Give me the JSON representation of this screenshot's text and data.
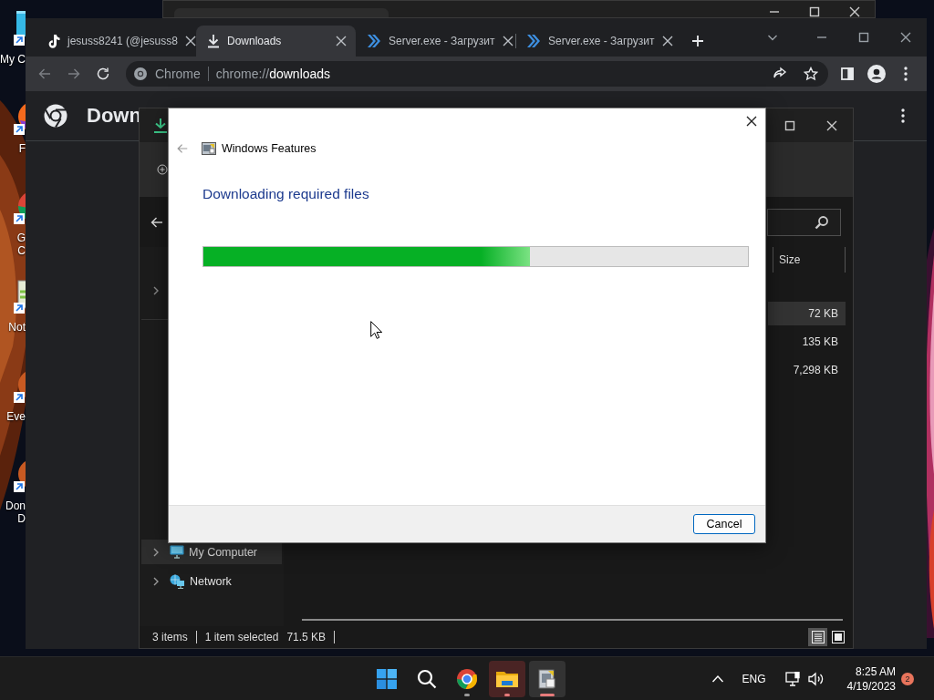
{
  "desktop": {
    "icons": [
      {
        "lines": [
          "My C"
        ],
        "kind": "computer"
      },
      {
        "lines": [
          "F"
        ],
        "kind": "firefox"
      },
      {
        "lines": [
          "G",
          "C"
        ],
        "kind": "chrome"
      },
      {
        "lines": [
          "Not"
        ],
        "kind": "notepad"
      },
      {
        "lines": [
          "Eve"
        ],
        "kind": "app"
      },
      {
        "lines": [
          "Don",
          "D"
        ],
        "kind": "app"
      }
    ]
  },
  "browser": {
    "tabs": [
      {
        "title": "jesuss8241 (@jesuss8",
        "kind": "tiktok",
        "selected": false
      },
      {
        "title": "Downloads",
        "kind": "download",
        "selected": true
      },
      {
        "title": "Server.exe - Загрузит",
        "kind": "server",
        "selected": false
      },
      {
        "title": "Server.exe - Загрузит",
        "kind": "server",
        "selected": false
      }
    ],
    "address": {
      "site": "Chrome",
      "url": "chrome://**downloads**"
    },
    "page_title": "Down"
  },
  "explorer": {
    "column": "Size",
    "rows": [
      {
        "size": "72 KB",
        "selected": true
      },
      {
        "size": "135 KB",
        "selected": false
      },
      {
        "size": "7,298 KB",
        "selected": false
      }
    ],
    "nav": [
      {
        "label": "My Computer",
        "kind": "computer",
        "selected": true
      },
      {
        "label": "Network",
        "kind": "network",
        "selected": false
      }
    ],
    "status": [
      "3 items",
      "1 item selected",
      "71.5 KB"
    ],
    "views": [
      {
        "kind": "details",
        "selected": true
      },
      {
        "kind": "tiles",
        "selected": false
      }
    ]
  },
  "dialog": {
    "title": "Windows Features",
    "heading": "Downloading required files",
    "progress": {
      "level": 0.6
    },
    "buttons": [
      "Cancel"
    ]
  },
  "taskbar": {
    "apps": [
      {
        "kind": "start"
      },
      {
        "kind": "search"
      },
      {
        "kind": "chrome",
        "running": true,
        "focused": false,
        "flashing": false
      },
      {
        "kind": "explorer",
        "running": true,
        "focused": false,
        "flashing": true
      },
      {
        "kind": "features",
        "running": true,
        "focused": true,
        "flashing": false
      }
    ],
    "language": "ENG",
    "time": "8:25 AM",
    "date": "4/19/2023",
    "notifications": "2"
  }
}
